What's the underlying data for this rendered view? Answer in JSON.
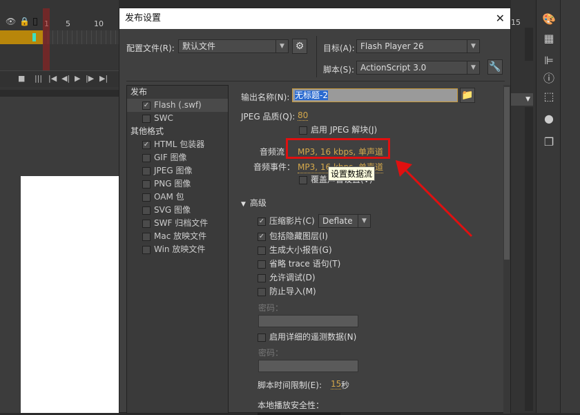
{
  "timeline": {
    "ruler": [
      "1",
      "5",
      "10",
      "15"
    ],
    "layer_icons": [
      "eye-icon",
      "lock-icon",
      "outline-icon"
    ],
    "controls": [
      "camera-icon",
      "layers-icon",
      "first-frame-icon",
      "prev-frame-icon",
      "play-icon",
      "next-frame-icon",
      "last-frame-icon"
    ]
  },
  "dialog": {
    "title": "发布设置",
    "profile_label": "配置文件(R):",
    "profile_value": "默认文件",
    "target_label": "目标(A):",
    "target_value": "Flash Player 26",
    "script_label": "脚本(S):",
    "script_value": "ActionScript 3.0",
    "formats": [
      {
        "label": "发布",
        "type": "header"
      },
      {
        "label": "Flash (.swf)",
        "checked": true,
        "active": true
      },
      {
        "label": "SWC",
        "checked": false
      },
      {
        "label": "其他格式",
        "type": "header"
      },
      {
        "label": "HTML 包装器",
        "checked": true
      },
      {
        "label": "GIF 图像",
        "checked": false
      },
      {
        "label": "JPEG 图像",
        "checked": false
      },
      {
        "label": "PNG 图像",
        "checked": false
      },
      {
        "label": "OAM 包",
        "checked": false
      },
      {
        "label": "SVG 图像",
        "checked": false
      },
      {
        "label": "SWF 归档文件",
        "checked": false
      },
      {
        "label": "Mac 放映文件",
        "checked": false
      },
      {
        "label": "Win 放映文件",
        "checked": false
      }
    ],
    "output_label": "输出名称(N):",
    "output_value": "无标题-2",
    "jpeg_label": "JPEG 品质(Q):",
    "jpeg_value": "80",
    "jpeg_deblock": "启用 JPEG 解块(J)",
    "audio_stream_label": "音频流：",
    "audio_stream_value": "MP3, 16 kbps, 单声道",
    "audio_event_label": "音频事件：",
    "audio_event_value": "MP3, 16 kbps, 单声道",
    "override_sound": "覆盖声音设置(V)",
    "tooltip": "设置数据流",
    "advanced_label": "高级",
    "compress": "压缩影片(C)",
    "compress_value": "Deflate",
    "include_hidden": "包括隐藏图层(I)",
    "size_report": "生成大小报告(G)",
    "omit_trace": "省略 trace 语句(T)",
    "permit_debug": "允许调试(D)",
    "protect_import": "防止导入(M)",
    "password_label": "密码：",
    "telemetry": "启用详细的遥测数据(N)",
    "password_label2": "密码：",
    "script_time_label": "脚本时间限制(E):",
    "script_time_value": "15",
    "script_time_unit": "秒",
    "local_security": "本地播放安全性：",
    "highlight_color": "#e01010"
  }
}
